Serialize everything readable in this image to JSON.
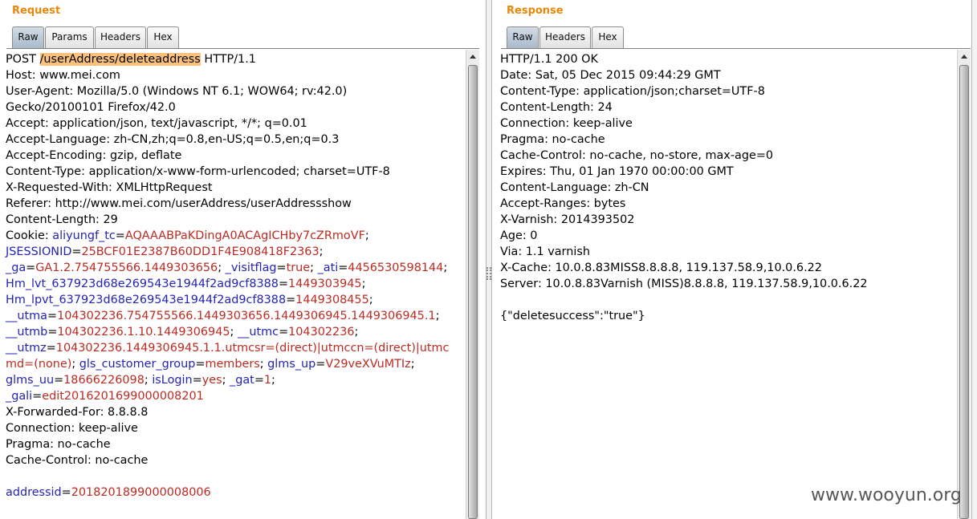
{
  "request": {
    "title": "Request",
    "tabs": [
      {
        "label": "Raw",
        "selected": true
      },
      {
        "label": "Params",
        "selected": false
      },
      {
        "label": "Headers",
        "selected": false
      },
      {
        "label": "Hex",
        "selected": false
      }
    ],
    "lines": [
      [
        {
          "text": "POST "
        },
        {
          "highlight": "/userAddress/deleteaddress"
        },
        {
          "text": " HTTP/1.1"
        }
      ],
      "Host: www.mei.com",
      "User-Agent: Mozilla/5.0 (Windows NT 6.1; WOW64; rv:42.0)",
      "Gecko/20100101 Firefox/42.0",
      "Accept: application/json, text/javascript, */*; q=0.01",
      "Accept-Language: zh-CN,zh;q=0.8,en-US;q=0.5,en;q=0.3",
      "Accept-Encoding: gzip, deflate",
      "Content-Type: application/x-www-form-urlencoded; charset=UTF-8",
      "X-Requested-With: XMLHttpRequest",
      "Referer: http://www.mei.com/userAddress/userAddressshow",
      "Content-Length: 29",
      [
        {
          "text": "Cookie: "
        },
        {
          "name": "aliyungf_tc"
        },
        {
          "text": "="
        },
        {
          "value": "AQAAABPaKDingA0ACAgICHby7cZRmoVF"
        },
        {
          "text": ";"
        }
      ],
      [
        {
          "name": "JSESSIONID"
        },
        {
          "text": "="
        },
        {
          "value": "25BCF01E2387B60DD1F4E908418F2363"
        },
        {
          "text": ";"
        }
      ],
      [
        {
          "name": "_ga"
        },
        {
          "text": "="
        },
        {
          "value": "GA1.2.754755566.1449303656"
        },
        {
          "text": "; "
        },
        {
          "name": "_visitflag"
        },
        {
          "text": "="
        },
        {
          "value": "true"
        },
        {
          "text": "; "
        },
        {
          "name": "_ati"
        },
        {
          "text": "="
        },
        {
          "value": "4456530598144"
        },
        {
          "text": ";"
        }
      ],
      [
        {
          "name": "Hm_lvt_637923d68e269543e1944f2ad9cf8388"
        },
        {
          "text": "="
        },
        {
          "value": "1449303945"
        },
        {
          "text": ";"
        }
      ],
      [
        {
          "name": "Hm_lpvt_637923d68e269543e1944f2ad9cf8388"
        },
        {
          "text": "="
        },
        {
          "value": "1449308455"
        },
        {
          "text": ";"
        }
      ],
      [
        {
          "name": "__utma"
        },
        {
          "text": "="
        },
        {
          "value": "104302236.754755566.1449303656.1449306945.1449306945.1"
        },
        {
          "text": ";"
        }
      ],
      [
        {
          "name": "__utmb"
        },
        {
          "text": "="
        },
        {
          "value": "104302236.1.10.1449306945"
        },
        {
          "text": "; "
        },
        {
          "name": "__utmc"
        },
        {
          "text": "="
        },
        {
          "value": "104302236"
        },
        {
          "text": ";"
        }
      ],
      [
        {
          "name": "__utmz"
        },
        {
          "text": "="
        },
        {
          "value": "104302236.1449306945.1.1.utmcsr=(direct)|utmccn=(direct)|utmc"
        }
      ],
      [
        {
          "value": "md=(none)"
        },
        {
          "text": "; "
        },
        {
          "name": "gls_customer_group"
        },
        {
          "text": "="
        },
        {
          "value": "members"
        },
        {
          "text": "; "
        },
        {
          "name": "glms_up"
        },
        {
          "text": "="
        },
        {
          "value": "V29veXVuMTIz"
        },
        {
          "text": ";"
        }
      ],
      [
        {
          "name": "glms_uu"
        },
        {
          "text": "="
        },
        {
          "value": "18666226098"
        },
        {
          "text": "; "
        },
        {
          "name": "isLogin"
        },
        {
          "text": "="
        },
        {
          "value": "yes"
        },
        {
          "text": "; "
        },
        {
          "name": "_gat"
        },
        {
          "text": "="
        },
        {
          "value": "1"
        },
        {
          "text": ";"
        }
      ],
      [
        {
          "name": "_gali"
        },
        {
          "text": "="
        },
        {
          "value": "edit2016201699000008201"
        }
      ],
      "X-Forwarded-For: 8.8.8.8",
      "Connection: keep-alive",
      "Pragma: no-cache",
      "Cache-Control: no-cache",
      "",
      [
        {
          "name": "addressid"
        },
        {
          "text": "="
        },
        {
          "value": "2018201899000008006"
        }
      ]
    ]
  },
  "response": {
    "title": "Response",
    "tabs": [
      {
        "label": "Raw",
        "selected": true
      },
      {
        "label": "Headers",
        "selected": false
      },
      {
        "label": "Hex",
        "selected": false
      }
    ],
    "lines": [
      "HTTP/1.1 200 OK",
      "Date: Sat, 05 Dec 2015 09:44:29 GMT",
      "Content-Type: application/json;charset=UTF-8",
      "Content-Length: 24",
      "Connection: keep-alive",
      "Pragma: no-cache",
      "Cache-Control: no-cache, no-store, max-age=0",
      "Expires: Thu, 01 Jan 1970 00:00:00 GMT",
      "Content-Language: zh-CN",
      "Accept-Ranges: bytes",
      "X-Varnish: 2014393502",
      "Age: 0",
      "Via: 1.1 varnish",
      "X-Cache: 10.0.8.83MISS8.8.8.8, 119.137.58.9,10.0.6.22",
      "Server: 10.0.8.83Varnish (MISS)8.8.8.8, 119.137.58.9,10.0.6.22",
      "",
      "{\"deletesuccess\":\"true\"}"
    ]
  },
  "watermark": "www.wooyun.org",
  "colors": {
    "pane_title": "#e8870c",
    "param_name": "#2323b5",
    "param_value": "#bb2b22",
    "selection_highlight": "#f9c17b",
    "selected_tab": "#a9bacb"
  },
  "icons": {
    "scrollbar_up": "up-arrow-icon",
    "divider_grip": "grip-icon"
  }
}
